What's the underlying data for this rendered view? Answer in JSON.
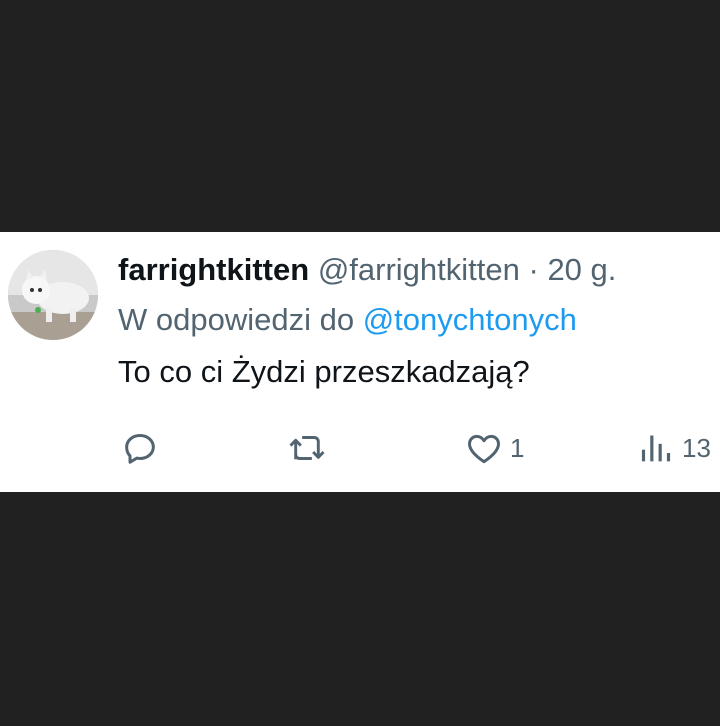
{
  "tweet": {
    "display_name": "farrightkitten",
    "handle": "@farrightkitten",
    "separator": "·",
    "timestamp": "20 g.",
    "reply_prefix": "W odpowiedzi do",
    "reply_to": "@tonychtonych",
    "text": "To co ci Żydzi przeszkadzają?"
  },
  "actions": {
    "reply": {
      "icon": "reply-icon",
      "count": ""
    },
    "retweet": {
      "icon": "retweet-icon",
      "count": ""
    },
    "like": {
      "icon": "heart-icon",
      "count": "1"
    },
    "views": {
      "icon": "views-icon",
      "count": "13"
    }
  },
  "colors": {
    "background": "#212121",
    "card": "#ffffff",
    "text_primary": "#0f1419",
    "text_secondary": "#536471",
    "accent": "#1d9bf0"
  }
}
